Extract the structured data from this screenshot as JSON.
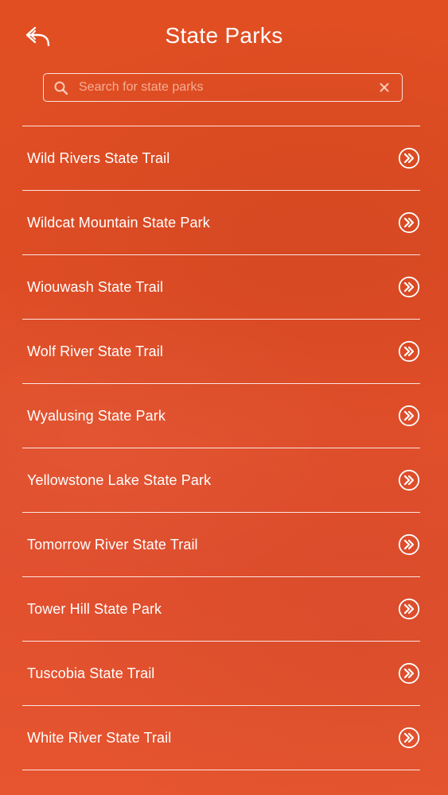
{
  "header": {
    "title": "State Parks",
    "back_icon": "back-reply-arrow-icon"
  },
  "search": {
    "placeholder": "Search for state parks",
    "value": "",
    "search_icon": "magnifier-icon",
    "clear_icon": "clear-x-icon"
  },
  "colors": {
    "background": "#e2512c",
    "foreground": "#ffffff"
  },
  "parks": [
    {
      "label": "Wild Rivers State Trail"
    },
    {
      "label": "Wildcat Mountain State Park"
    },
    {
      "label": "Wiouwash State Trail"
    },
    {
      "label": "Wolf River State Trail"
    },
    {
      "label": "Wyalusing State Park"
    },
    {
      "label": "Yellowstone Lake State Park"
    },
    {
      "label": "Tomorrow River State Trail"
    },
    {
      "label": "Tower Hill State Park"
    },
    {
      "label": "Tuscobia State Trail"
    },
    {
      "label": "White River State Trail"
    }
  ]
}
